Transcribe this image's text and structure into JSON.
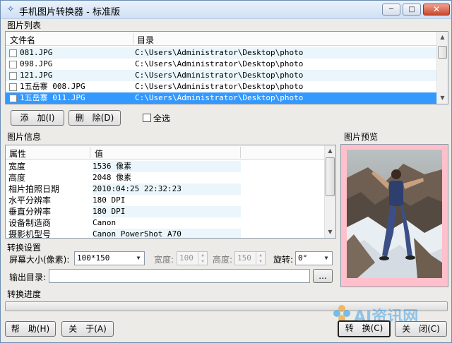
{
  "window": {
    "title": "手机图片转换器 - 标准版",
    "minimize_glyph": "─",
    "maximize_glyph": "□",
    "close_glyph": "✕"
  },
  "image_list": {
    "section_title": "图片列表",
    "columns": [
      "文件名",
      "目录"
    ],
    "rows": [
      {
        "name": "081.JPG",
        "dir": "C:\\Users\\Administrator\\Desktop\\photo"
      },
      {
        "name": "098.JPG",
        "dir": "C:\\Users\\Administrator\\Desktop\\photo"
      },
      {
        "name": "121.JPG",
        "dir": "C:\\Users\\Administrator\\Desktop\\photo"
      },
      {
        "name": "1五岳寨 008.JPG",
        "dir": "C:\\Users\\Administrator\\Desktop\\photo"
      },
      {
        "name": "1五岳寨 011.JPG",
        "dir": "C:\\Users\\Administrator\\Desktop\\photo"
      }
    ],
    "add_label": "添　加(I)",
    "delete_label": "删　除(D)",
    "select_all_label": "全选"
  },
  "image_info": {
    "section_title": "图片信息",
    "columns": [
      "属性",
      "值"
    ],
    "rows": [
      {
        "key": "宽度",
        "value": "1536 像素"
      },
      {
        "key": "高度",
        "value": "2048 像素"
      },
      {
        "key": "相片拍照日期",
        "value": "2010:04:25 22:32:23"
      },
      {
        "key": "水平分辨率",
        "value": "180 DPI"
      },
      {
        "key": "垂直分辨率",
        "value": "180 DPI"
      },
      {
        "key": "设备制造商",
        "value": "Canon"
      },
      {
        "key": "摄影机型号",
        "value": "Canon PowerShot A70"
      }
    ]
  },
  "preview": {
    "section_title": "图片预览"
  },
  "convert_settings": {
    "section_title": "转换设置",
    "screen_size_label": "屏幕大小(像素):",
    "screen_size_value": "100*150",
    "width_label": "宽度:",
    "width_value": "100",
    "height_label": "高度:",
    "height_value": "150",
    "rotate_label": "旋转:",
    "rotate_value": "0°",
    "output_dir_label": "输出目录:",
    "output_dir_value": "",
    "browse_label": "..."
  },
  "progress": {
    "section_title": "转换进度",
    "value": 0
  },
  "footer": {
    "help_label": "帮　助(H)",
    "about_label": "关　于(A)",
    "convert_label": "转　换(C)",
    "close_label": "关　闭(C)"
  },
  "watermark": {
    "text": "AI资讯网"
  },
  "colors": {
    "selection": "#3399ff",
    "alt_row": "#eaf6fb",
    "preview_border": "#ffc0cb"
  }
}
